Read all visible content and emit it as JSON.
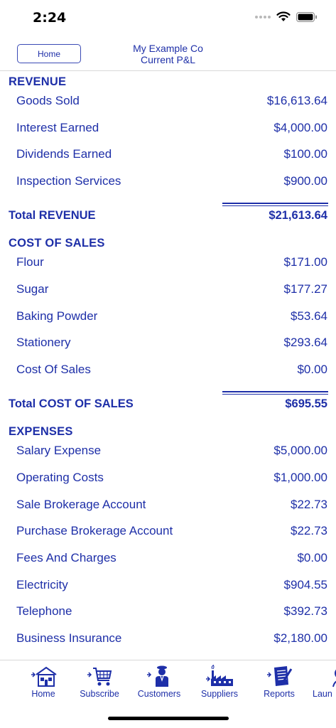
{
  "status_bar": {
    "time": "2:24"
  },
  "navbar": {
    "home_button": "Home",
    "company": "My Example Co",
    "report_title": "Current P&L"
  },
  "report": {
    "revenue": {
      "header": "REVENUE",
      "items": [
        {
          "label": "Goods Sold",
          "amount": "$16,613.64"
        },
        {
          "label": "Interest Earned",
          "amount": "$4,000.00"
        },
        {
          "label": "Dividends Earned",
          "amount": "$100.00"
        },
        {
          "label": "Inspection Services",
          "amount": "$900.00"
        }
      ],
      "total_label": "Total REVENUE",
      "total_amount": "$21,613.64"
    },
    "cost_of_sales": {
      "header": "COST OF SALES",
      "items": [
        {
          "label": "Flour",
          "amount": "$171.00"
        },
        {
          "label": "Sugar",
          "amount": "$177.27"
        },
        {
          "label": "Baking Powder",
          "amount": "$53.64"
        },
        {
          "label": "Stationery",
          "amount": "$293.64"
        },
        {
          "label": "Cost Of Sales",
          "amount": "$0.00"
        }
      ],
      "total_label": "Total COST OF SALES",
      "total_amount": "$695.55"
    },
    "expenses": {
      "header": "EXPENSES",
      "items": [
        {
          "label": "Salary Expense",
          "amount": "$5,000.00"
        },
        {
          "label": "Operating Costs",
          "amount": "$1,000.00"
        },
        {
          "label": "Sale Brokerage Account",
          "amount": "$22.73"
        },
        {
          "label": "Purchase Brokerage Account",
          "amount": "$22.73"
        },
        {
          "label": "Fees And Charges",
          "amount": "$0.00"
        },
        {
          "label": "Electricity",
          "amount": "$904.55"
        },
        {
          "label": "Telephone",
          "amount": "$392.73"
        },
        {
          "label": "Business Insurance",
          "amount": "$2,180.00"
        }
      ]
    }
  },
  "tabbar": {
    "tabs": [
      {
        "label": "Home",
        "icon": "house-icon"
      },
      {
        "label": "Subscribe",
        "icon": "cart-icon"
      },
      {
        "label": "Customers",
        "icon": "person-icon"
      },
      {
        "label": "Suppliers",
        "icon": "factory-icon"
      },
      {
        "label": "Reports",
        "icon": "report-icon"
      },
      {
        "label": "Laun",
        "icon": "launch-icon"
      }
    ]
  },
  "colors": {
    "accent": "#1e2fa8",
    "background": "#ffffff"
  }
}
